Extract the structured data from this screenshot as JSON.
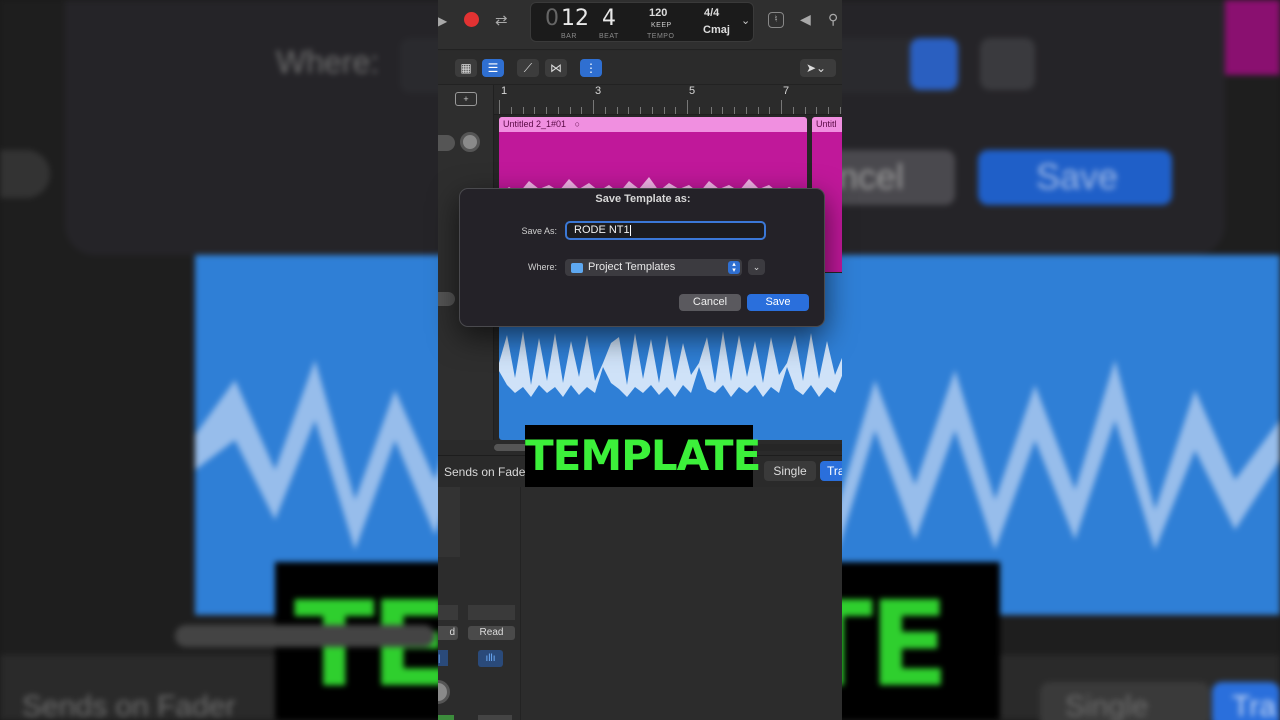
{
  "background": {
    "where_label": "Where:",
    "cancel_label": "ncel",
    "save_label": "Save",
    "sends_label": "Sends on Fader",
    "single_label": "Single",
    "tra_label": "Tra",
    "template_text": "TEMPLATE"
  },
  "transport": {
    "bar_value": "12",
    "beat_value": "4",
    "bar_caption": "BAR",
    "beat_caption": "BEAT",
    "tempo_value": "120",
    "tempo_keep": "KEEP",
    "tempo_caption": "TEMPO",
    "time_signature": "4/4",
    "key": "Cmaj"
  },
  "ruler": {
    "marks": [
      "1",
      "3",
      "5",
      "7"
    ]
  },
  "regions": {
    "region1_name": "Untitled 2_1#01",
    "region2_name": "Untitl"
  },
  "mixer": {
    "sends_label": "Sends on Fader",
    "single_label": "Single",
    "tra_label": "Tra",
    "read_label": "Read",
    "partial_read_label": "d"
  },
  "banner": {
    "text": "TEMPLATE"
  },
  "dialog": {
    "title": "Save Template as:",
    "save_as_label": "Save As:",
    "save_as_value": "RODE NT1",
    "where_label": "Where:",
    "where_value": "Project Templates",
    "cancel_label": "Cancel",
    "save_label": "Save"
  },
  "colors": {
    "region_pink": "#c0189a",
    "region_pink_head": "#f08fe0",
    "region_blue": "#2f7fd6",
    "banner_green": "#3cf03a",
    "accent_blue": "#2a6fdc"
  }
}
